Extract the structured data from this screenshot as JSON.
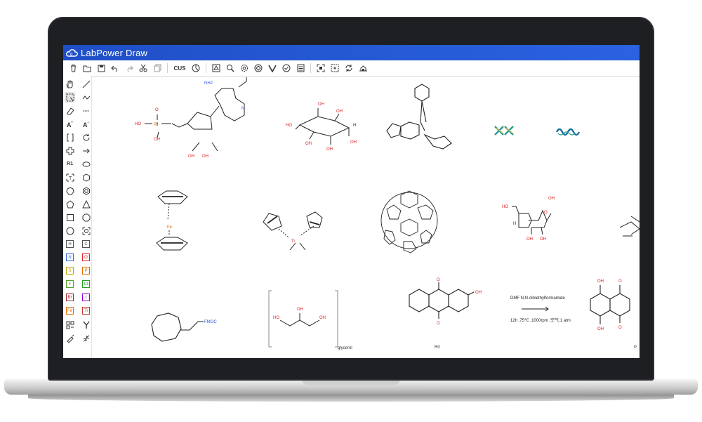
{
  "app": {
    "title": "LabPower Draw",
    "brand_color": "#2457d6"
  },
  "toolbar": {
    "cus_label": "CUS",
    "icons": [
      "clear-icon",
      "open-icon",
      "save-icon",
      "undo-icon",
      "redo-icon",
      "cut-icon",
      "copy-icon",
      "template-icon",
      "clean-icon",
      "analyze-icon",
      "settings-icon",
      "clean2d-icon",
      "chiral-icon",
      "check-icon",
      "calculator-icon",
      "fit-icon",
      "select-all-icon",
      "rotate-icon",
      "export-icon"
    ]
  },
  "sidebar": {
    "text_tool": "R1",
    "elements": [
      {
        "symbol": "H",
        "color": "#555555"
      },
      {
        "symbol": "C",
        "color": "#555555"
      },
      {
        "symbol": "N",
        "color": "#3366dd"
      },
      {
        "symbol": "O",
        "color": "#dd2222"
      },
      {
        "symbol": "S",
        "color": "#c8a000"
      },
      {
        "symbol": "P",
        "color": "#e07000"
      },
      {
        "symbol": "F",
        "color": "#5aa02c"
      },
      {
        "symbol": "Cl",
        "color": "#2ca02c"
      },
      {
        "symbol": "Br",
        "color": "#a52a2a"
      },
      {
        "symbol": "I",
        "color": "#9400d3"
      },
      {
        "symbol": "Fe",
        "color": "#e07000"
      },
      {
        "symbol": "Ti",
        "color": "#c0392b"
      }
    ]
  },
  "canvas": {
    "atp": {
      "nh2": "NH2",
      "n": "N",
      "oh_p": "HO",
      "p": "P",
      "o": "O",
      "oh": "OH"
    },
    "inositol": {
      "oh": "OH",
      "h": "H",
      "ho": "HO"
    },
    "ferrocene": {
      "metal": "Fe"
    },
    "titanocene": {
      "metal": "Ti"
    },
    "ribose": {
      "ho": "HO",
      "oh": "OH",
      "o": "O",
      "h": "H"
    },
    "fmoc": {
      "group": "FMOC"
    },
    "glycerol": {
      "oh": "OH",
      "ho": "HO",
      "label": "glycerol"
    },
    "anthraquinone": {
      "o": "O",
      "oh": "OH",
      "label": "R0"
    },
    "reaction": {
      "reagent": "DMF N,N-dimethylformamide",
      "conditions": "12h ,75℃ ,1000rpm ,空气,1 atm"
    },
    "product": {
      "oh": "OH",
      "o": "O",
      "label": "P"
    }
  }
}
